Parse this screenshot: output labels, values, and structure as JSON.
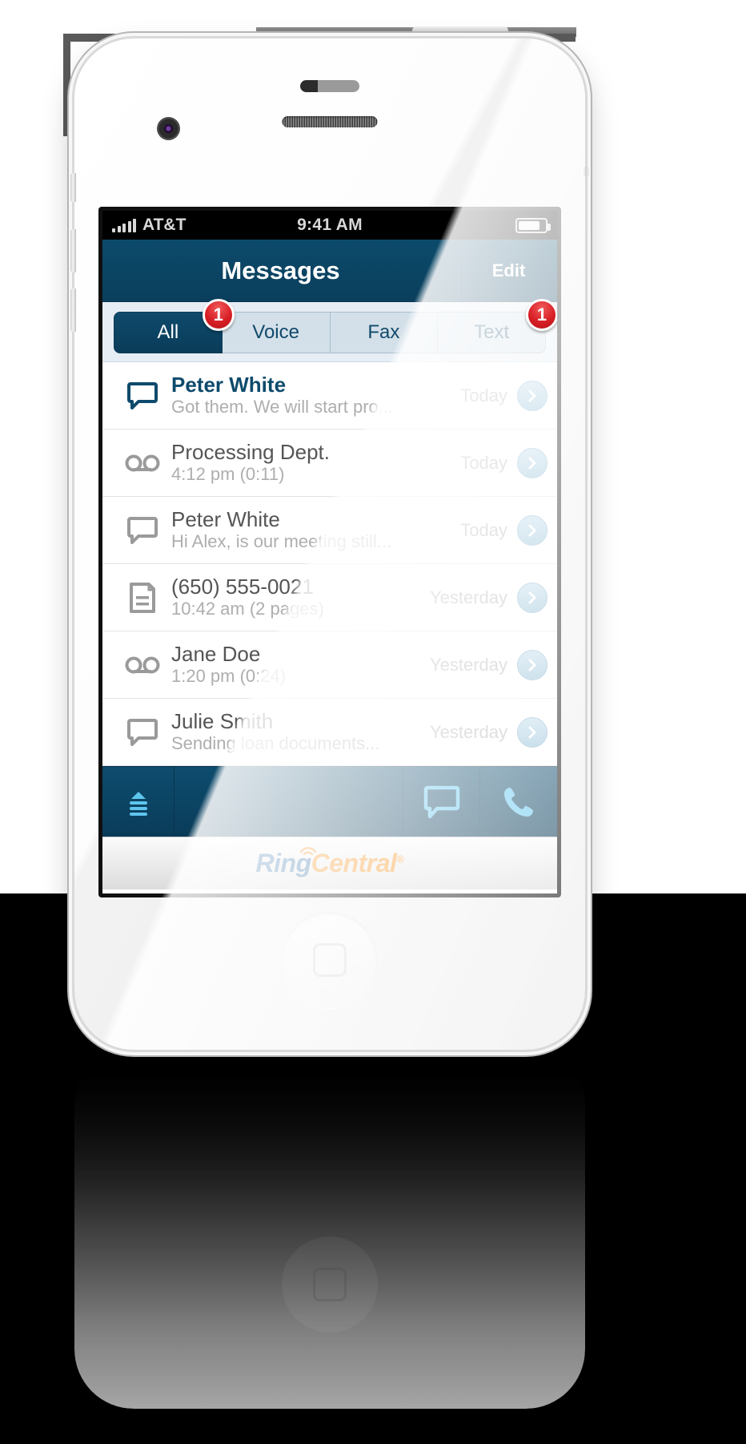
{
  "status_bar": {
    "carrier": "AT&T",
    "time": "9:41 AM",
    "signal_icon": "signal-bars-icon",
    "battery_icon": "battery-icon"
  },
  "nav": {
    "title": "Messages",
    "edit_label": "Edit"
  },
  "tabs": [
    {
      "label": "All",
      "active": true,
      "badge": "1"
    },
    {
      "label": "Voice",
      "active": false,
      "badge": ""
    },
    {
      "label": "Fax",
      "active": false,
      "badge": ""
    },
    {
      "label": "Text",
      "active": false,
      "badge": "1"
    }
  ],
  "messages": [
    {
      "icon": "chat-bubble-icon",
      "name": "Peter White",
      "detail": "Got them. We will start pro...",
      "time": "Today",
      "unread": true
    },
    {
      "icon": "voicemail-icon",
      "name": "Processing Dept.",
      "detail": "4:12 pm (0:11)",
      "time": "Today",
      "unread": false
    },
    {
      "icon": "chat-bubble-icon",
      "name": "Peter White",
      "detail": "Hi Alex, is our meeting still...",
      "time": "Today",
      "unread": false
    },
    {
      "icon": "fax-page-icon",
      "name": "(650) 555-0021",
      "detail": "10:42 am (2 pages)",
      "time": "Yesterday",
      "unread": false
    },
    {
      "icon": "voicemail-icon",
      "name": "Jane Doe",
      "detail": "1:20 pm (0:24)",
      "time": "Yesterday",
      "unread": false
    },
    {
      "icon": "chat-bubble-icon",
      "name": "Julie Smith",
      "detail": "Sending loan documents...",
      "time": "Yesterday",
      "unread": false
    }
  ],
  "toolbar": {
    "eject_icon": "eject-upload-icon",
    "message_icon": "chat-bubble-icon",
    "call_icon": "phone-handset-icon"
  },
  "branding": {
    "logo_first": "Ring",
    "logo_second": "Central",
    "registered_mark": "®"
  },
  "colors": {
    "brand_blue": "#0e4a6c",
    "brand_orange": "#f6921e",
    "logo_blue": "#2e6da4",
    "accent_cyan": "#5ec5ef",
    "badge_red": "#d81f26",
    "segment_bg": "#d3e0e9",
    "segbar_bg": "#e6edf4"
  }
}
